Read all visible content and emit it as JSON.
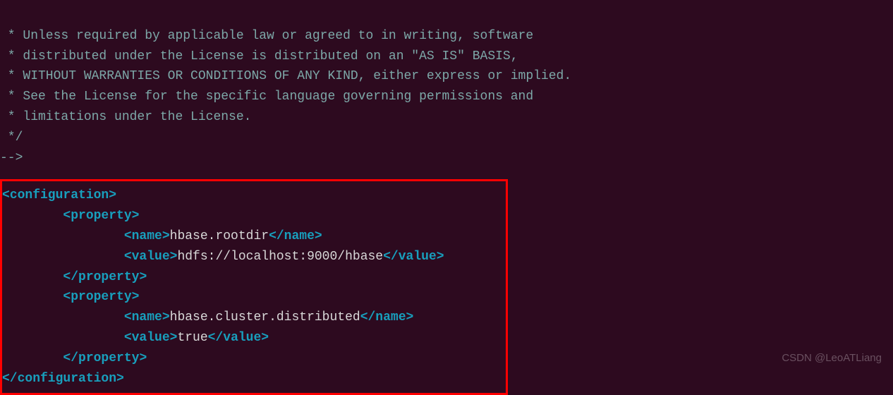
{
  "comment": {
    "line1": " * Unless required by applicable law or agreed to in writing, software",
    "line2": " * distributed under the License is distributed on an \"AS IS\" BASIS,",
    "line3": " * WITHOUT WARRANTIES OR CONDITIONS OF ANY KIND, either express or implied.",
    "line4": " * See the License for the specific language governing permissions and",
    "line5": " * limitations under the License.",
    "line6": " */",
    "line7": "-->"
  },
  "xml": {
    "configuration_open": "<configuration>",
    "configuration_close": "</configuration>",
    "property_open": "<property>",
    "property_close": "</property>",
    "name_open": "<name>",
    "name_close": "</name>",
    "value_open": "<value>",
    "value_close": "</value>",
    "prop1_name": "hbase.rootdir",
    "prop1_value": "hdfs://localhost:9000/hbase",
    "prop2_name": "hbase.cluster.distributed",
    "prop2_value": "true"
  },
  "indent": {
    "l1": "        ",
    "l2": "                "
  },
  "watermark": "CSDN @LeoATLiang"
}
